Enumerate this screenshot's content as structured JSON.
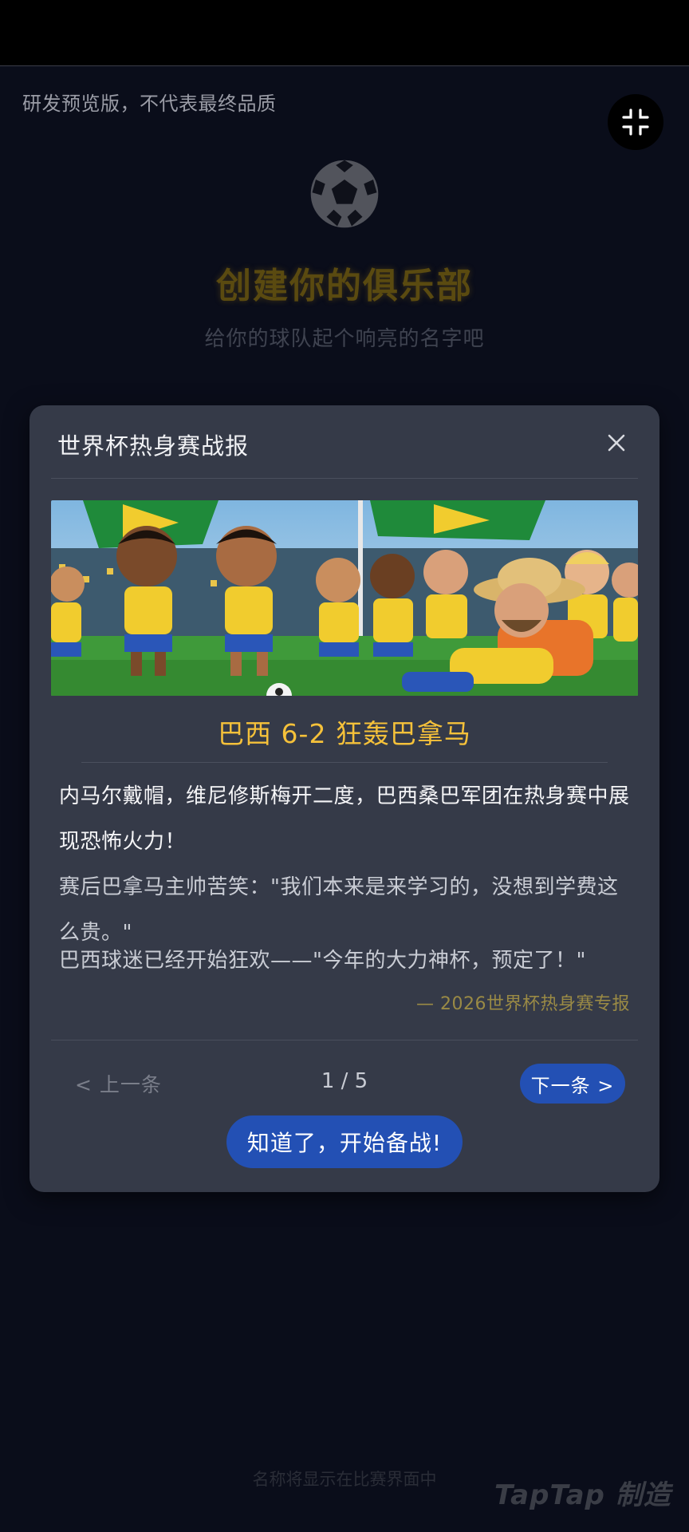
{
  "status_bar": {},
  "preview_note": "研发预览版，不代表最终品质",
  "background": {
    "title": "创建你的俱乐部",
    "subtitle": "给你的球队起个响亮的名字吧",
    "footer_hint": "名称将显示在比赛界面中",
    "watermark": "TapTap 制造"
  },
  "modal": {
    "title": "世界杯热身赛战报",
    "headline": "巴西 6-2 狂轰巴拿马",
    "paragraphs": [
      "内马尔戴帽，维尼修斯梅开二度，巴西桑巴军团在热身赛中展现恐怖火力！",
      "赛后巴拿马主帅苦笑：\"我们本来是来学习的，没想到学费这么贵。\"",
      "巴西球迷已经开始狂欢——\"今年的大力神杯，预定了！\""
    ],
    "source": "— 2026世界杯热身赛专报",
    "prev_label": "< 上一条",
    "pager": "1 / 5",
    "next_label": "下一条 >",
    "confirm_label": "知道了，开始备战!"
  },
  "colors": {
    "accent": "#2350b4",
    "headline": "#f5c13a",
    "modal_bg": "#353a48",
    "page_bg": "#0a0d1a"
  },
  "icons": [
    "collapse-icon",
    "soccer-ball-icon",
    "close-icon"
  ]
}
